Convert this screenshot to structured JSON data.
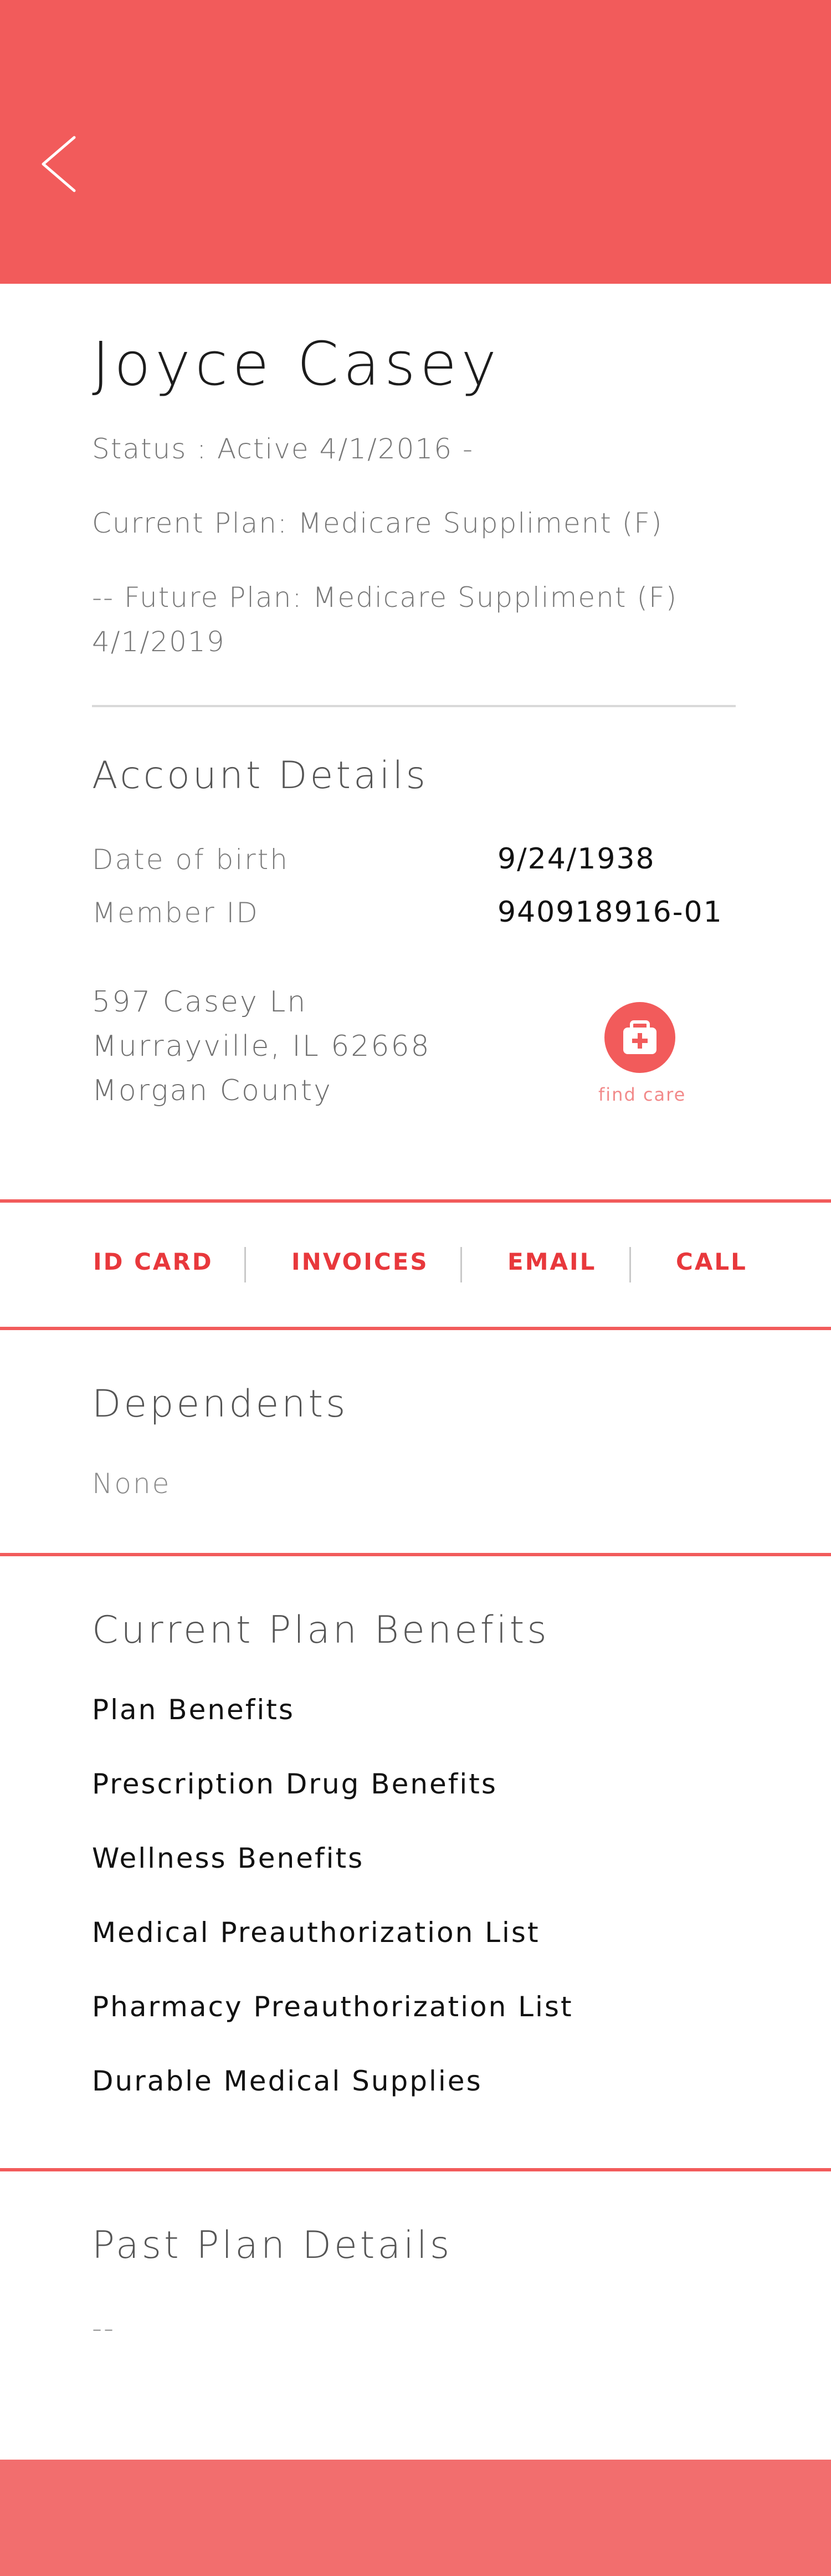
{
  "header": {
    "back_icon": "chevron-left-icon",
    "color": "#f25b5b"
  },
  "member": {
    "name": "Joyce Casey",
    "status": "Status : Active 4/1/2016 -",
    "current_plan": "Current Plan: Medicare Suppliment (F)",
    "future_plan_line1": "-- Future Plan: Medicare Suppliment (F)",
    "future_plan_line2": "4/1/2019"
  },
  "account": {
    "title": "Account Details",
    "dob_label": "Date of birth",
    "dob_value": "9/24/1938",
    "member_id_label": "Member ID",
    "member_id_value": "940918916-01",
    "address_line1": "597 Casey Ln",
    "address_line2": "Murrayville, IL 62668",
    "address_line3": "Morgan County",
    "find_care_label": "find care",
    "find_care_icon": "first-aid-kit-icon"
  },
  "actions": {
    "id_card": "ID CARD",
    "invoices": "INVOICES",
    "email": "EMAIL",
    "call": "CALL"
  },
  "dependents": {
    "title": "Dependents",
    "value": "None"
  },
  "benefits": {
    "title": "Current Plan Benefits",
    "items": [
      "Plan Benefits",
      "Prescription Drug Benefits",
      "Wellness Benefits",
      "Medical Preauthorization List",
      "Pharmacy Preauthorization List",
      "Durable Medical Supplies"
    ]
  },
  "past_plan": {
    "title": "Past Plan Details",
    "value": "--"
  },
  "colors": {
    "accent": "#f25b5b",
    "action_text": "#e8383c",
    "footer": "#f26e6e"
  }
}
